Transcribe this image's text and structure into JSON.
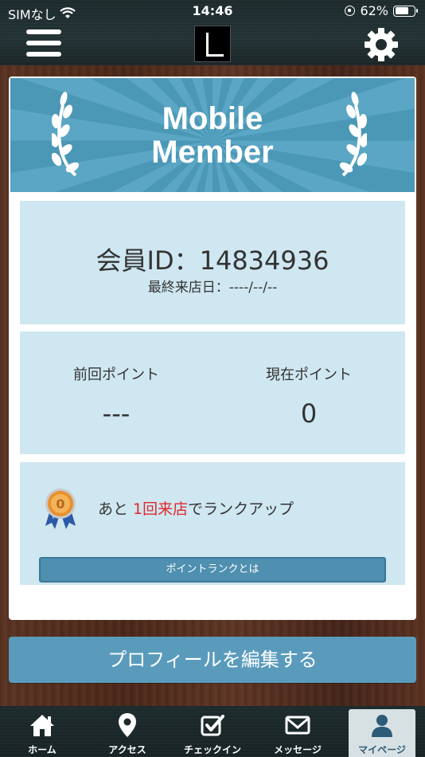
{
  "status_bar": {
    "carrier": "SIMなし",
    "time": "14:46",
    "battery": "62%",
    "battery_level": 0.62
  },
  "header": {
    "menu_icon": "hamburger-menu-icon",
    "logo_icon": "shop-logo",
    "settings_icon": "gear-icon"
  },
  "banner": {
    "title_line1": "Mobile",
    "title_line2": "Member",
    "bg_color": "#5aa6c4"
  },
  "member": {
    "id_label": "会員ID：14834936",
    "last_visit": "最終来店日：----/--/--"
  },
  "points": {
    "previous_label": "前回ポイント",
    "previous_value": "---",
    "current_label": "現在ポイント",
    "current_value": "0"
  },
  "rank": {
    "prefix": "あと ",
    "highlight": "1回来店",
    "suffix": "でランクアップ",
    "medal_number": "0",
    "button_label": "ポイントランクとは",
    "highlight_color": "#e0282c"
  },
  "edit_profile_label": "プロフィールを編集する",
  "tabs": [
    {
      "label": "ホーム",
      "icon": "home-icon"
    },
    {
      "label": "アクセス",
      "icon": "map-pin-icon"
    },
    {
      "label": "チェックイン",
      "icon": "checkbox-icon"
    },
    {
      "label": "メッセージ",
      "icon": "envelope-icon"
    },
    {
      "label": "マイページ",
      "icon": "user-icon",
      "active": true
    }
  ]
}
